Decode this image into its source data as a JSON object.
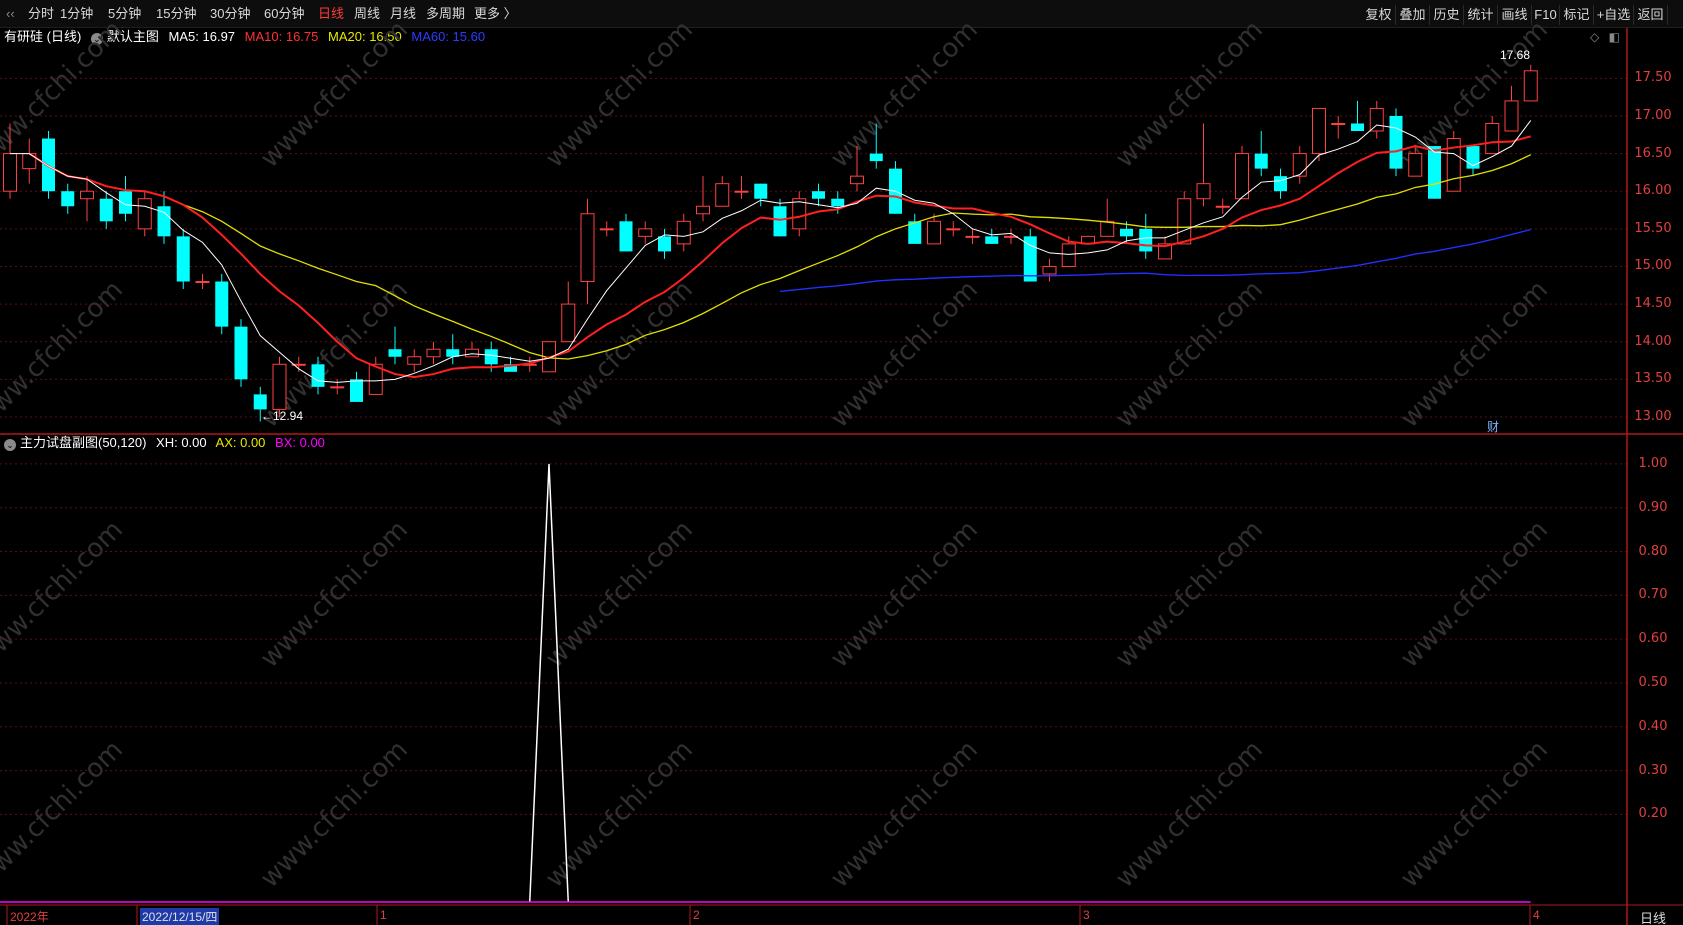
{
  "toolbar": {
    "periods": [
      "分时",
      "1分钟",
      "5分钟",
      "15分钟",
      "30分钟",
      "60分钟",
      "日线",
      "周线",
      "月线",
      "多周期",
      "更多 〉"
    ],
    "active_period": "日线",
    "right_buttons": [
      "复权",
      "叠加",
      "历史",
      "统计",
      "画线",
      "F10",
      "标记",
      "+自选",
      "返回"
    ]
  },
  "main_chart": {
    "stock_label": "有研硅 (日线)",
    "template_label": "默认主图",
    "ma5": "MA5: 16.97",
    "ma10": "MA10: 16.75",
    "ma20": "MA20: 16.50",
    "ma60": "MA60: 15.60",
    "high_marker": "17.68",
    "low_marker": "←12.94",
    "finance_marker": "财"
  },
  "sub_chart": {
    "label": "主力试盘副图(50,120)",
    "xh": "XH: 0.00",
    "ax": "AX: 0.00",
    "bx": "BX: 0.00"
  },
  "y_axis_main": [
    "17.50",
    "17.00",
    "16.50",
    "16.00",
    "15.50",
    "15.00",
    "14.50",
    "14.00",
    "13.50",
    "13.00"
  ],
  "y_axis_sub": [
    "1.00",
    "0.90",
    "0.80",
    "0.70",
    "0.60",
    "0.50",
    "0.40",
    "0.30",
    "0.20"
  ],
  "x_axis": {
    "dates": [
      "2022年",
      "2022/12/15/四",
      "1",
      "2",
      "3",
      "4"
    ],
    "bottom_period": "日线"
  },
  "colors": {
    "up": "#ff4040",
    "down": "#00ffff",
    "ma5": "#ffffff",
    "ma10": "#ff2020",
    "ma20": "#e0e000",
    "ma60": "#2030ff",
    "xh": "#ffffff",
    "ax": "#ffff00",
    "bx": "#ff00ff",
    "axis": "#e04040"
  },
  "watermark": "www.cfchi.com",
  "chart_data": [
    {
      "type": "candlestick",
      "ylim": [
        12.8,
        17.85
      ],
      "candles": [
        [
          16.0,
          16.5,
          16.9,
          15.9
        ],
        [
          16.3,
          16.5,
          16.7,
          16.1
        ],
        [
          16.7,
          16.0,
          16.8,
          15.9
        ],
        [
          16.0,
          15.8,
          16.1,
          15.7
        ],
        [
          15.9,
          16.0,
          16.2,
          15.6
        ],
        [
          15.9,
          15.6,
          16.0,
          15.5
        ],
        [
          16.0,
          15.7,
          16.2,
          15.6
        ],
        [
          15.5,
          15.9,
          16.0,
          15.4
        ],
        [
          15.8,
          15.4,
          16.0,
          15.3
        ],
        [
          15.4,
          14.8,
          15.5,
          14.7
        ],
        [
          14.8,
          14.8,
          14.9,
          14.7
        ],
        [
          14.8,
          14.2,
          14.9,
          14.1
        ],
        [
          14.2,
          13.5,
          14.3,
          13.4
        ],
        [
          13.3,
          13.1,
          13.4,
          12.94
        ],
        [
          13.1,
          13.7,
          13.8,
          13.0
        ],
        [
          13.7,
          13.7,
          13.8,
          13.6
        ],
        [
          13.7,
          13.4,
          13.8,
          13.3
        ],
        [
          13.4,
          13.4,
          13.5,
          13.3
        ],
        [
          13.5,
          13.2,
          13.6,
          13.2
        ],
        [
          13.3,
          13.7,
          13.8,
          13.3
        ],
        [
          13.9,
          13.8,
          14.2,
          13.7
        ],
        [
          13.7,
          13.8,
          13.9,
          13.6
        ],
        [
          13.8,
          13.9,
          14.0,
          13.7
        ],
        [
          13.9,
          13.8,
          14.1,
          13.7
        ],
        [
          13.8,
          13.9,
          14.0,
          13.8
        ],
        [
          13.9,
          13.7,
          14.0,
          13.6
        ],
        [
          13.7,
          13.6,
          13.8,
          13.6
        ],
        [
          13.7,
          13.7,
          13.8,
          13.6
        ],
        [
          13.6,
          14.0,
          14.0,
          13.6
        ],
        [
          14.0,
          14.5,
          14.8,
          14.0
        ],
        [
          14.8,
          15.7,
          15.9,
          14.5
        ],
        [
          15.5,
          15.5,
          15.6,
          15.4
        ],
        [
          15.6,
          15.2,
          15.7,
          15.2
        ],
        [
          15.4,
          15.5,
          15.6,
          15.3
        ],
        [
          15.4,
          15.2,
          15.5,
          15.1
        ],
        [
          15.3,
          15.6,
          15.7,
          15.2
        ],
        [
          15.7,
          15.8,
          16.2,
          15.6
        ],
        [
          15.8,
          16.1,
          16.2,
          15.8
        ],
        [
          16.0,
          16.0,
          16.2,
          15.9
        ],
        [
          16.1,
          15.9,
          16.1,
          15.8
        ],
        [
          15.8,
          15.4,
          15.9,
          15.4
        ],
        [
          15.5,
          15.9,
          16.0,
          15.4
        ],
        [
          16.0,
          15.9,
          16.1,
          15.8
        ],
        [
          15.9,
          15.8,
          16.0,
          15.7
        ],
        [
          16.1,
          16.2,
          16.6,
          16.0
        ],
        [
          16.5,
          16.4,
          16.9,
          16.3
        ],
        [
          16.3,
          15.7,
          16.4,
          15.7
        ],
        [
          15.6,
          15.3,
          15.7,
          15.3
        ],
        [
          15.3,
          15.6,
          15.7,
          15.3
        ],
        [
          15.5,
          15.5,
          15.6,
          15.4
        ],
        [
          15.4,
          15.4,
          15.5,
          15.3
        ],
        [
          15.4,
          15.3,
          15.5,
          15.3
        ],
        [
          15.4,
          15.4,
          15.5,
          15.3
        ],
        [
          15.4,
          14.8,
          15.5,
          14.8
        ],
        [
          14.9,
          15.0,
          15.1,
          14.8
        ],
        [
          15.0,
          15.3,
          15.4,
          15.0
        ],
        [
          15.3,
          15.4,
          15.4,
          15.3
        ],
        [
          15.4,
          15.6,
          15.9,
          15.4
        ],
        [
          15.5,
          15.4,
          15.6,
          15.3
        ],
        [
          15.5,
          15.2,
          15.7,
          15.1
        ],
        [
          15.1,
          15.3,
          15.4,
          15.1
        ],
        [
          15.3,
          15.9,
          16.0,
          15.3
        ],
        [
          15.9,
          16.1,
          16.9,
          15.8
        ],
        [
          15.8,
          15.8,
          15.9,
          15.7
        ],
        [
          15.9,
          16.5,
          16.6,
          15.9
        ],
        [
          16.5,
          16.3,
          16.8,
          16.2
        ],
        [
          16.2,
          16.0,
          16.3,
          15.9
        ],
        [
          16.2,
          16.5,
          16.6,
          16.1
        ],
        [
          16.5,
          17.1,
          17.1,
          16.4
        ],
        [
          16.9,
          16.9,
          17.0,
          16.7
        ],
        [
          16.9,
          16.8,
          17.2,
          16.8
        ],
        [
          16.8,
          17.1,
          17.2,
          16.7
        ],
        [
          17.0,
          16.3,
          17.1,
          16.2
        ],
        [
          16.2,
          16.5,
          16.6,
          16.2
        ],
        [
          16.6,
          15.9,
          16.6,
          15.9
        ],
        [
          16.0,
          16.7,
          16.8,
          16.0
        ],
        [
          16.6,
          16.3,
          16.6,
          16.2
        ],
        [
          16.5,
          16.9,
          17.0,
          16.5
        ],
        [
          16.8,
          17.2,
          17.4,
          16.8
        ],
        [
          17.2,
          17.6,
          17.68,
          17.2
        ]
      ]
    },
    {
      "type": "line",
      "series": [
        {
          "name": "XH",
          "values": [
            0,
            0,
            0,
            0,
            0,
            0,
            0,
            0,
            0,
            0,
            0,
            0,
            0,
            0,
            0,
            0,
            0,
            0,
            0,
            0,
            0,
            0,
            0,
            0,
            0,
            0,
            0,
            0,
            1.0,
            0,
            0,
            0,
            0,
            0,
            0,
            0,
            0,
            0,
            0,
            0,
            0,
            0,
            0,
            0,
            0,
            0,
            0,
            0,
            0,
            0,
            0,
            0,
            0,
            0,
            0,
            0,
            0,
            0,
            0,
            0,
            0,
            0,
            0,
            0,
            0,
            0,
            0,
            0,
            0,
            0,
            0,
            0,
            0,
            0,
            0,
            0,
            0,
            0,
            0,
            0
          ]
        },
        {
          "name": "AX",
          "values": [
            0
          ]
        },
        {
          "name": "BX",
          "values": [
            0
          ]
        }
      ],
      "ylim": [
        0,
        1.05
      ]
    }
  ]
}
